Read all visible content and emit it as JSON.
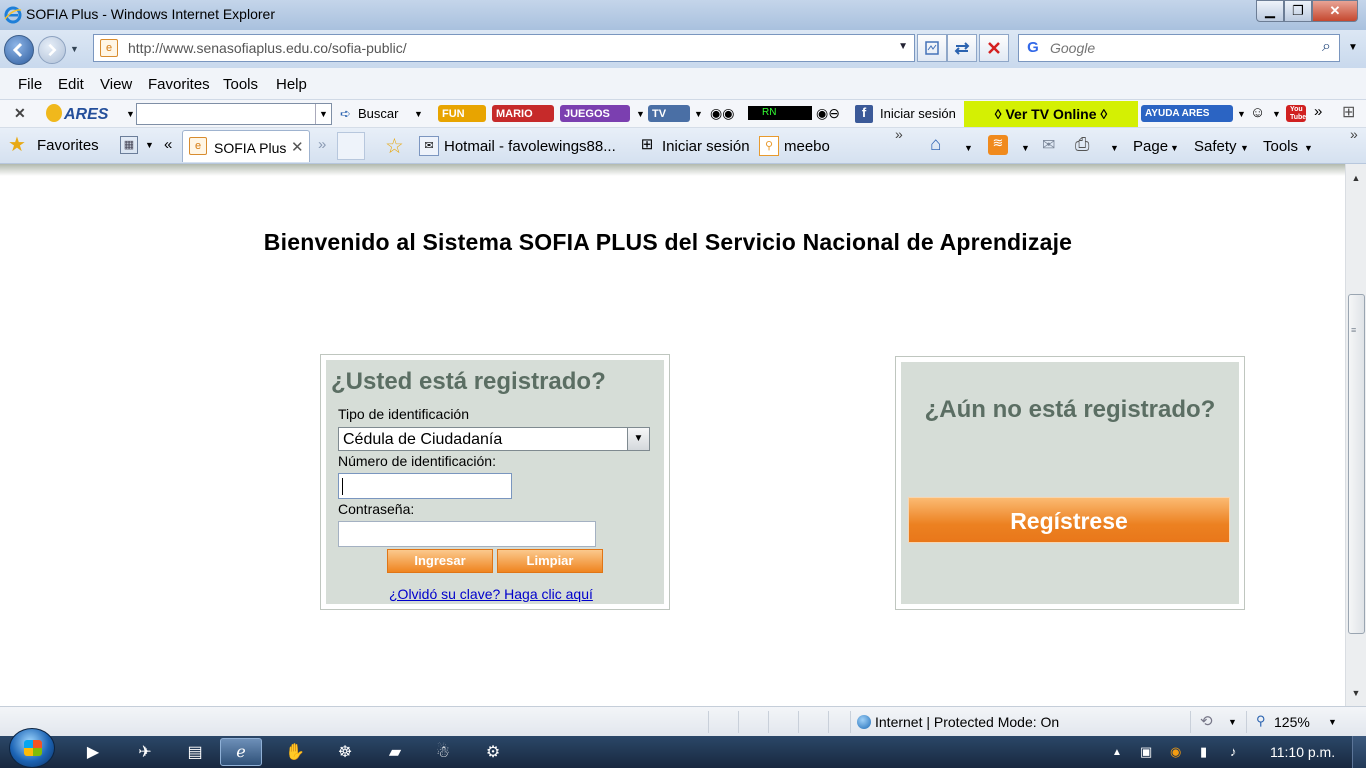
{
  "window": {
    "title": "SOFIA Plus - Windows Internet Explorer",
    "controls": {
      "minimize": "▁",
      "maximize": "❐",
      "close": "✕"
    }
  },
  "address_bar": {
    "url": "http://www.senasofiaplus.edu.co/sofia-public/",
    "search_placeholder": "Google"
  },
  "menu": {
    "items": [
      "File",
      "Edit",
      "View",
      "Favorites",
      "Tools",
      "Help"
    ]
  },
  "ares_toolbar": {
    "logo": "ARES",
    "buscar": "Buscar",
    "fun": "FUN",
    "mario": "MARIO",
    "juegos": "JUEGOS",
    "tv": "TV",
    "radio": "RN",
    "iniciar_sesion": "Iniciar sesión",
    "ver_tv": "◊ Ver TV Online ◊",
    "ayuda": "AYUDA ARES",
    "youtube": "You Tube"
  },
  "favorites_bar": {
    "favorites_label": "Favorites",
    "tab_label": "SOFIA Plus",
    "links": [
      {
        "label": "Hotmail - favolewings88..."
      },
      {
        "label": "Iniciar sesión"
      },
      {
        "label": "meebo"
      }
    ],
    "commands": [
      "Page",
      "Safety",
      "Tools"
    ]
  },
  "page": {
    "heading": "Bienvenido al Sistema SOFIA PLUS del Servicio Nacional de Aprendizaje",
    "login": {
      "title": "¿Usted está registrado?",
      "id_type_label": "Tipo de identificación",
      "id_type_value": "Cédula de Ciudadanía",
      "id_number_label": "Número de identificación:",
      "password_label": "Contraseña:",
      "submit_label": "Ingresar",
      "clear_label": "Limpiar",
      "forgot_link": "¿Olvidó su clave? Haga clic aquí"
    },
    "register": {
      "title": "¿Aún no está registrado?",
      "button_label": "Regístrese"
    }
  },
  "status_bar": {
    "zone": "Internet | Protected Mode: On",
    "zoom": "125%"
  },
  "taskbar": {
    "clock": "11:10 p.m."
  },
  "colors": {
    "panel_bg": "#d6ddd7",
    "panel_title": "#5b6e63",
    "orange_button": "#ef8420",
    "tv_online_bg": "#d4f003"
  }
}
